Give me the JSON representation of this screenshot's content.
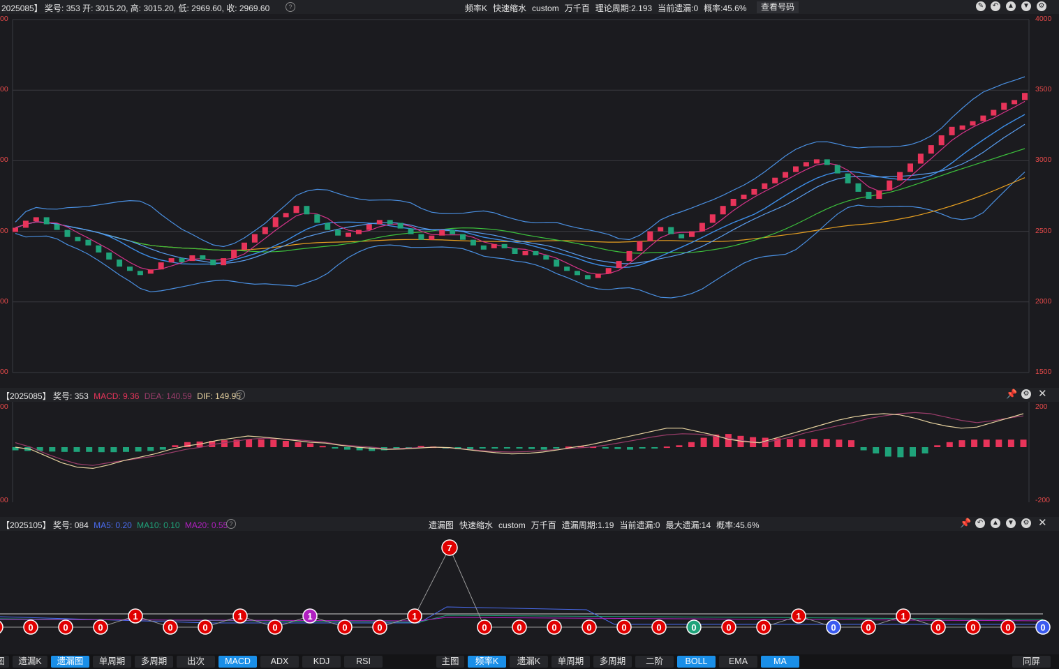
{
  "main_header": {
    "info": "2025085】 奖号: 353  开: 3015.20, 高: 3015.20, 低: 2969.60, 收: 2969.60",
    "items": [
      "频率K",
      "快速缩水",
      "custom",
      "万千百",
      "理论周期:2.193",
      "当前遗漏:0",
      "概率:45.6%"
    ],
    "view_button": "查看号码"
  },
  "main_axis_right": [
    "4000",
    "3500",
    "3000",
    "2500",
    "2000",
    "1500"
  ],
  "main_axis_left": [
    "00",
    "00",
    "00",
    "00",
    "00",
    "00"
  ],
  "macd_header": {
    "prefix": "【2025085】 奖号: 353",
    "macd": "MACD: 9.36",
    "dea": "DEA: 140.59",
    "dif": "DIF: 149.95"
  },
  "macd_axis_right": [
    "200",
    "-200"
  ],
  "macd_axis_left": [
    "00",
    "00"
  ],
  "miss_header": {
    "prefix": "【2025105】 奖号: 084",
    "ma5": "MA5: 0.20",
    "ma10": "MA10: 0.10",
    "ma20": "MA20: 0.55",
    "items": [
      "遗漏图",
      "快速缩水",
      "custom",
      "万千百",
      "遗漏周期:1.19",
      "当前遗漏:0",
      "最大遗漏:14",
      "概率:45.6%"
    ]
  },
  "miss_points": [
    "0",
    "0",
    "0",
    "0",
    "1",
    "0",
    "0",
    "1",
    "0",
    "1",
    "0",
    "0",
    "1",
    "7",
    "0",
    "0",
    "0",
    "0",
    "0",
    "0",
    "0",
    "0",
    "0",
    "1",
    "0",
    "0",
    "1",
    "0",
    "0",
    "0",
    "0"
  ],
  "left_tabs": [
    {
      "label": "图",
      "active": false
    },
    {
      "label": "遗漏K",
      "active": false
    },
    {
      "label": "遗漏图",
      "active": true
    },
    {
      "label": "单周期",
      "active": false
    },
    {
      "label": "多周期",
      "active": false
    },
    {
      "label": "出次",
      "active": false
    },
    {
      "label": "MACD",
      "active": true
    },
    {
      "label": "ADX",
      "active": false
    },
    {
      "label": "KDJ",
      "active": false
    },
    {
      "label": "RSI",
      "active": false
    }
  ],
  "right_tabs": [
    {
      "label": "主图",
      "active": false
    },
    {
      "label": "频率K",
      "active": true
    },
    {
      "label": "遗漏K",
      "active": false
    },
    {
      "label": "单周期",
      "active": false
    },
    {
      "label": "多周期",
      "active": false
    },
    {
      "label": "二阶",
      "active": false
    },
    {
      "label": "BOLL",
      "active": true
    },
    {
      "label": "EMA",
      "active": false
    },
    {
      "label": "MA",
      "active": true
    }
  ],
  "sync_button": "同屏",
  "colors": {
    "up": "#e8345a",
    "down": "#1fa37a",
    "ma_fast": "#d6338a",
    "ma_mid": "#3d8ee8",
    "ma_slow": "#3cc13c",
    "ma_long": "#e8a020",
    "boll": "#4a90e2",
    "red_axis": "#e84a4a",
    "tab_active": "#1a8fe8"
  },
  "chart_data": [
    {
      "type": "candlestick",
      "title": "频率K",
      "ylim": [
        1500,
        4000
      ],
      "y_ticks": [
        4000,
        3500,
        3000,
        2500,
        2000,
        1500
      ],
      "series": [
        {
          "name": "close",
          "values": [
            2525,
            2575,
            2600,
            2550,
            2510,
            2460,
            2440,
            2400,
            2350,
            2300,
            2250,
            2220,
            2200,
            2230,
            2280,
            2310,
            2290,
            2330,
            2300,
            2260,
            2310,
            2370,
            2420,
            2480,
            2530,
            2600,
            2630,
            2680,
            2620,
            2560,
            2510,
            2470,
            2490,
            2510,
            2550,
            2580,
            2560,
            2520,
            2480,
            2440,
            2470,
            2510,
            2480,
            2440,
            2400,
            2380,
            2410,
            2380,
            2340,
            2360,
            2330,
            2300,
            2250,
            2220,
            2190,
            2170,
            2200,
            2240,
            2290,
            2360,
            2430,
            2500,
            2530,
            2480,
            2460,
            2500,
            2560,
            2620,
            2680,
            2730,
            2760,
            2800,
            2840,
            2880,
            2920,
            2960,
            2990,
            3010,
            2970,
            2910,
            2840,
            2780,
            2730,
            2790,
            2860,
            2920,
            2980,
            3050,
            3110,
            3180,
            3240,
            3250,
            3280,
            3320,
            3360,
            3410,
            3430,
            3480
          ]
        }
      ]
    },
    {
      "type": "bar",
      "title": "MACD",
      "ylim": [
        -200,
        200
      ],
      "series": [
        {
          "name": "MACD",
          "values": [
            -10,
            -12,
            -12,
            -14,
            -15,
            -15,
            -15,
            -16,
            -16,
            -15,
            -14,
            -12,
            -8,
            6,
            16,
            18,
            20,
            22,
            24,
            25,
            25,
            24,
            20,
            16,
            12,
            4,
            -2,
            -8,
            -10,
            -12,
            -10,
            -6,
            -2,
            4,
            2,
            -2,
            -6,
            -8,
            -4,
            -2,
            -3,
            -4,
            -6,
            -8,
            -4,
            2,
            4,
            2,
            -2,
            -6,
            -8,
            -4,
            -2,
            2,
            6,
            16,
            30,
            40,
            42,
            36,
            32,
            30,
            28,
            26,
            26,
            26,
            26,
            24,
            22,
            -10,
            -20,
            -30,
            -32,
            -30,
            -20,
            6,
            16,
            22,
            24,
            24,
            24,
            24,
            24
          ]
        },
        {
          "name": "DEA",
          "values": [
            20,
            0,
            -30,
            -55,
            -75,
            -82,
            -70,
            -60,
            -50,
            -40,
            -25,
            -10,
            0,
            15,
            25,
            35,
            40,
            38,
            34,
            28,
            22,
            10,
            5,
            0,
            -8,
            -5,
            -2,
            0,
            -3,
            -8,
            -15,
            -20,
            -22,
            -20,
            -15,
            -10,
            -5,
            0,
            8,
            20,
            32,
            45,
            55,
            60,
            58,
            50,
            40,
            28,
            20,
            30,
            45,
            65,
            80,
            95,
            110,
            128,
            140,
            150,
            155,
            150,
            135,
            120,
            110,
            118,
            130,
            140
          ]
        },
        {
          "name": "DIF",
          "values": [
            0,
            -10,
            -40,
            -70,
            -90,
            -95,
            -80,
            -60,
            -45,
            -30,
            -10,
            5,
            15,
            30,
            40,
            50,
            45,
            38,
            30,
            22,
            18,
            8,
            0,
            -5,
            -10,
            -8,
            -4,
            0,
            -2,
            -10,
            -18,
            -25,
            -30,
            -28,
            -22,
            -12,
            0,
            10,
            25,
            40,
            55,
            70,
            85,
            85,
            70,
            55,
            35,
            25,
            20,
            40,
            60,
            80,
            100,
            120,
            135,
            145,
            150,
            145,
            130,
            110,
            95,
            85,
            90,
            110,
            130,
            150
          ]
        }
      ]
    },
    {
      "type": "line",
      "title": "遗漏图",
      "series": [
        {
          "name": "遗漏",
          "values": [
            0,
            0,
            0,
            0,
            1,
            0,
            0,
            1,
            0,
            1,
            0,
            0,
            1,
            7,
            0,
            0,
            0,
            0,
            0,
            0,
            0,
            0,
            0,
            1,
            0,
            0,
            1,
            0,
            0,
            0,
            0
          ]
        },
        {
          "name": "MA5",
          "values": [
            0.2
          ]
        },
        {
          "name": "MA10",
          "values": [
            0.1
          ]
        },
        {
          "name": "MA20",
          "values": [
            0.55
          ]
        }
      ]
    }
  ]
}
